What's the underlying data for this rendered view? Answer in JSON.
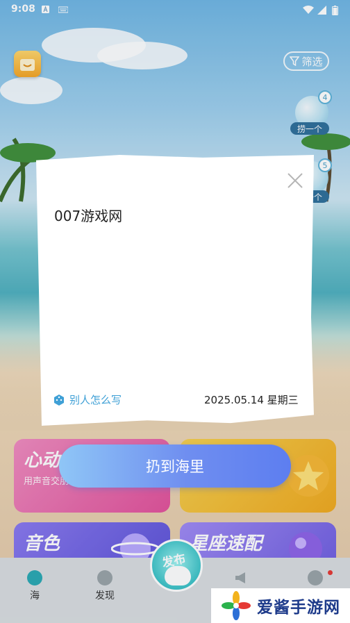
{
  "status_bar": {
    "time": "9:08"
  },
  "top": {
    "filter_label": "筛选"
  },
  "bottles": [
    {
      "catch_label": "捞一个",
      "count": "4"
    },
    {
      "catch_label": "捞一个",
      "count": "5"
    }
  ],
  "cards": [
    {
      "title": "心动",
      "subtitle": "用声音交朋"
    },
    {
      "title": "",
      "subtitle": ""
    },
    {
      "title": "音色",
      "subtitle": ""
    },
    {
      "title": "星座速配",
      "subtitle": ""
    }
  ],
  "tabs": [
    {
      "label": "海"
    },
    {
      "label": "发现"
    },
    {
      "label": ""
    },
    {
      "label": ""
    }
  ],
  "publish": {
    "label": "发布"
  },
  "dialog": {
    "content": "007游戏网",
    "others_label": "别人怎么写",
    "date": "2025.05.14 星期三"
  },
  "throw_button": {
    "label": "扔到海里"
  },
  "watermark": {
    "text": "爱酱手游网"
  },
  "colors": {
    "accent_blue": "#3fa0d6",
    "button_gradient_start": "#8fc6f6",
    "button_gradient_end": "#5d7ef0",
    "publish_teal": "#3cc3c8"
  }
}
